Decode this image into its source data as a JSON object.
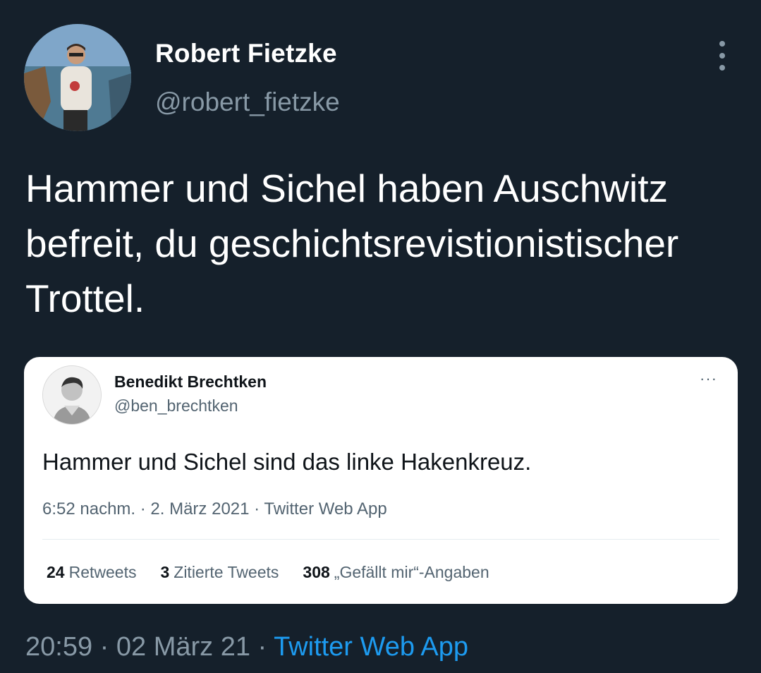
{
  "tweet": {
    "author_name": "Robert Fietzke",
    "author_handle": "@robert_fietzke",
    "text": "Hammer und Sichel haben Auschwitz befreit, du geschichtsrevistionistischer Trottel.",
    "time": "20:59",
    "separator": "·",
    "date": "02 März 21",
    "source": "Twitter Web App",
    "more_icon": "more-vertical-icon"
  },
  "quote": {
    "author_name": "Benedikt Brechtken",
    "author_handle": "@ben_brechtken",
    "more_label": "···",
    "text": "Hammer und Sichel sind das linke Hakenkreuz.",
    "meta": "6:52 nachm. · 2. März 2021 · Twitter Web App",
    "stats": [
      {
        "count": "24",
        "label": "Retweets"
      },
      {
        "count": "3",
        "label": "Zitierte Tweets"
      },
      {
        "count": "308",
        "label": "„Gefällt mir“-Angaben"
      }
    ]
  },
  "colors": {
    "background": "#15202b",
    "text_primary": "#ffffff",
    "text_secondary": "#8899a6",
    "link": "#1d9bf0",
    "card_background": "#ffffff"
  }
}
